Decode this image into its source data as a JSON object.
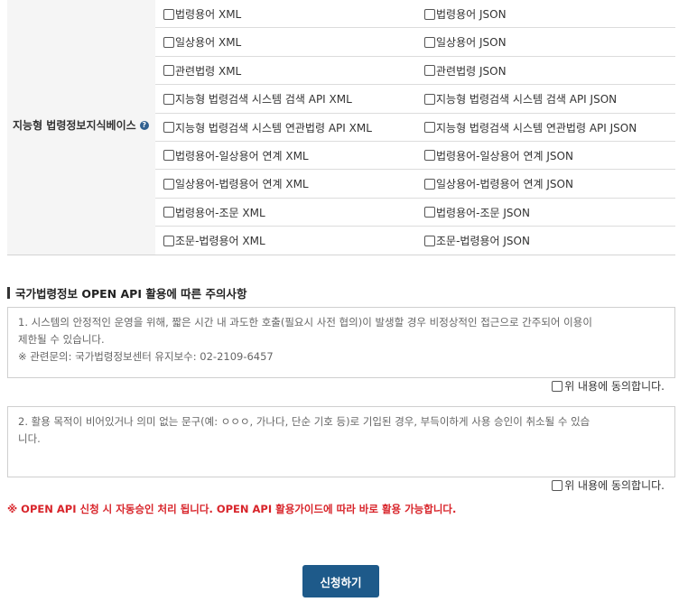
{
  "table": {
    "header_label": "지능형 법령정보지식베이스",
    "help_glyph": "?",
    "rows": [
      {
        "left": "법령용어 XML",
        "right": "법령용어 JSON"
      },
      {
        "left": "일상용어 XML",
        "right": "일상용어 JSON"
      },
      {
        "left": "관련법령 XML",
        "right": "관련법령 JSON"
      },
      {
        "left": "지능형 법령검색 시스템 검색 API XML",
        "right": "지능형 법령검색 시스템 검색 API JSON"
      },
      {
        "left": "지능형 법령검색 시스템 연관법령 API XML",
        "right": "지능형 법령검색 시스템 연관법령 API JSON"
      },
      {
        "left": "법령용어-일상용어 연계 XML",
        "right": "법령용어-일상용어 연계 JSON"
      },
      {
        "left": "일상용어-법령용어 연계 XML",
        "right": "일상용어-법령용어 연계 JSON"
      },
      {
        "left": "법령용어-조문 XML",
        "right": "법령용어-조문 JSON"
      },
      {
        "left": "조문-법령용어 XML",
        "right": "조문-법령용어 JSON"
      }
    ]
  },
  "notice": {
    "title": "국가법령정보 OPEN API 활용에 따른 주의사항",
    "box1_lines": [
      "1. 시스템의 안정적인 운영을 위해, 짧은 시간 내 과도한 호출(필요시 사전 협의)이 발생할 경우 비정상적인 접근으로 간주되어 이용이",
      "제한될 수 있습니다.",
      "※ 관련문의: 국가법령정보센터 유지보수: 02-2109-6457"
    ],
    "box2_lines": [
      "2. 활용 목적이 비어있거나 의미 없는 문구(예: ㅇㅇㅇ, 가나다, 단순 기호 등)로 기입된 경우, 부득이하게 사용 승인이 취소될 수 있습",
      "니다."
    ],
    "agree_label": "위 내용에 동의합니다.",
    "warning": "※ OPEN API 신청 시 자동승인 처리 됩니다. OPEN API 활용가이드에 따라 바로 활용 가능합니다."
  },
  "submit_label": "신청하기"
}
